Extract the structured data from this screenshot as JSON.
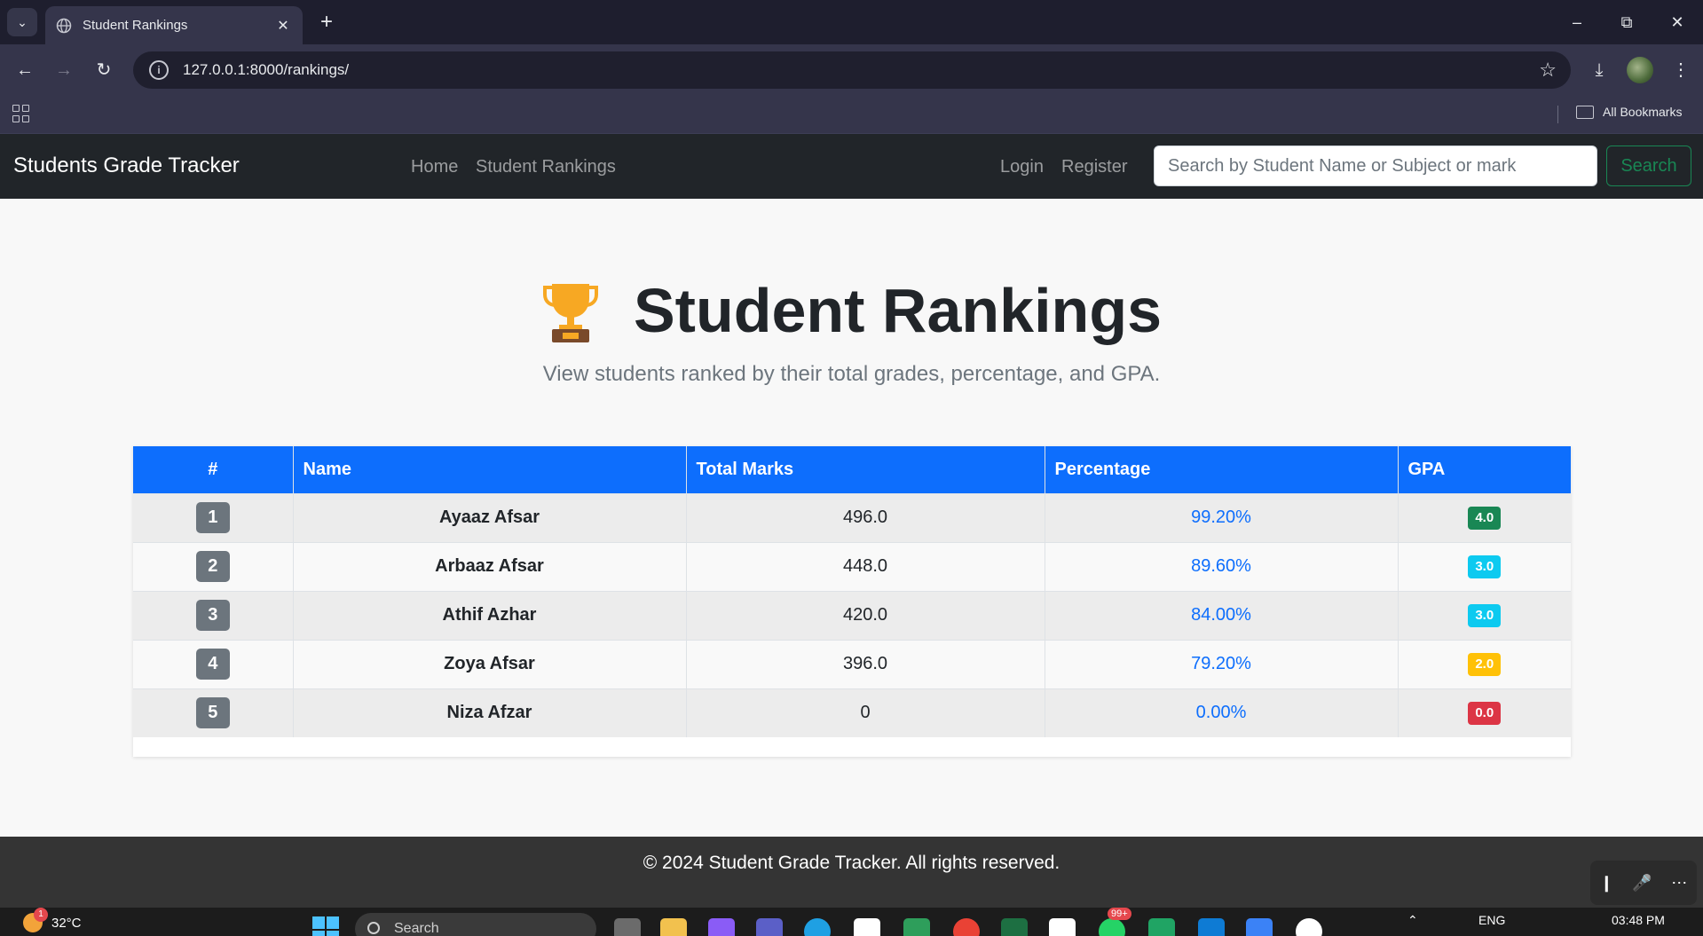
{
  "browser": {
    "tab_title": "Student Rankings",
    "url": "127.0.0.1:8000/rankings/",
    "bookmarks_label": "All Bookmarks"
  },
  "nav": {
    "brand": "Students Grade Tracker",
    "links": [
      "Home",
      "Student Rankings"
    ],
    "login": "Login",
    "register": "Register",
    "search_placeholder": "Search by Student Name or Subject or mark",
    "search_button": "Search"
  },
  "page": {
    "title": "Student Rankings",
    "subtitle": "View students ranked by their total grades, percentage, and GPA."
  },
  "table": {
    "headers": [
      "#",
      "Name",
      "Total Marks",
      "Percentage",
      "GPA"
    ],
    "rows": [
      {
        "rank": "1",
        "name": "Ayaaz Afsar",
        "total": "496.0",
        "percentage": "99.20%",
        "gpa": "4.0",
        "gpa_color": "#198754"
      },
      {
        "rank": "2",
        "name": "Arbaaz Afsar",
        "total": "448.0",
        "percentage": "89.60%",
        "gpa": "3.0",
        "gpa_color": "#0dcaf0"
      },
      {
        "rank": "3",
        "name": "Athif Azhar",
        "total": "420.0",
        "percentage": "84.00%",
        "gpa": "3.0",
        "gpa_color": "#0dcaf0"
      },
      {
        "rank": "4",
        "name": "Zoya Afsar",
        "total": "396.0",
        "percentage": "79.20%",
        "gpa": "2.0",
        "gpa_color": "#ffc107"
      },
      {
        "rank": "5",
        "name": "Niza Afzar",
        "total": "0",
        "percentage": "0.00%",
        "gpa": "0.0",
        "gpa_color": "#dc3545"
      }
    ]
  },
  "footer": {
    "text": "© 2024 Student Grade Tracker. All rights reserved."
  },
  "taskbar": {
    "weather_temp": "32°C",
    "weather_badge": "1",
    "search_label": "Search",
    "notification_badge": "99+",
    "language": "ENG",
    "time": "03:48 PM"
  },
  "colors": {
    "navbar_bg": "#212529",
    "table_header_bg": "#0d6efd",
    "search_button": "#198754",
    "percentage_text": "#0d6efd"
  }
}
